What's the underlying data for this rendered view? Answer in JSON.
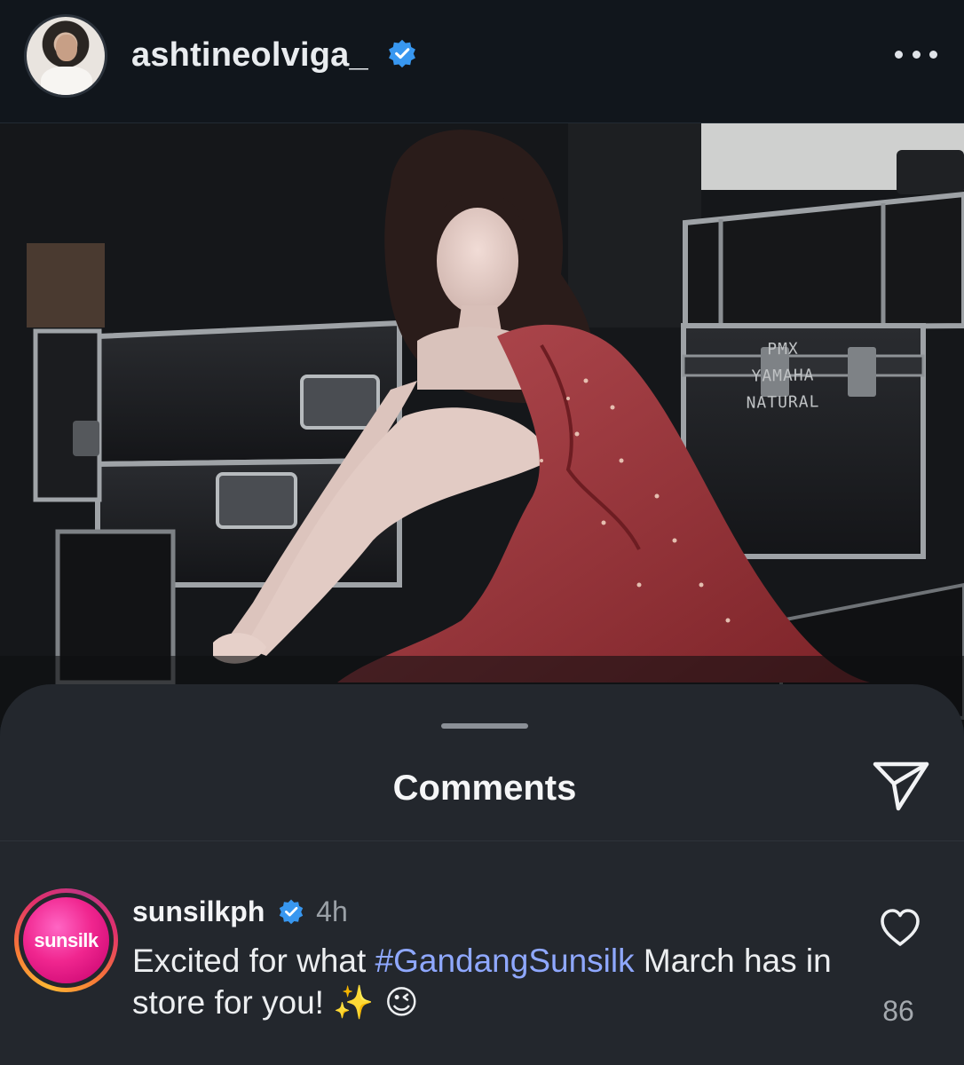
{
  "post": {
    "username": "ashtineolviga_",
    "verified": true,
    "more_icon": "more-horizontal-icon",
    "photo_case_text": [
      "PMX",
      "YAMAHA",
      "NATURAL"
    ]
  },
  "comments_sheet": {
    "title": "Comments",
    "share_icon": "paper-plane-icon",
    "comments": [
      {
        "username": "sunsilkph",
        "verified": true,
        "time": "4h",
        "avatar_text": "sunsilk",
        "text_before": "Excited for what ",
        "hashtag": "#GandangSunsilk",
        "text_after": " March has in store for you! ",
        "emojis": "✨ 😉",
        "likes": "86",
        "like_icon": "heart-outline-icon"
      }
    ]
  },
  "colors": {
    "background": "#12171d",
    "sheet": "#23272d",
    "hashtag": "#8fa8ff",
    "verified": "#3897f0",
    "brand_pink": "#f0268f"
  }
}
